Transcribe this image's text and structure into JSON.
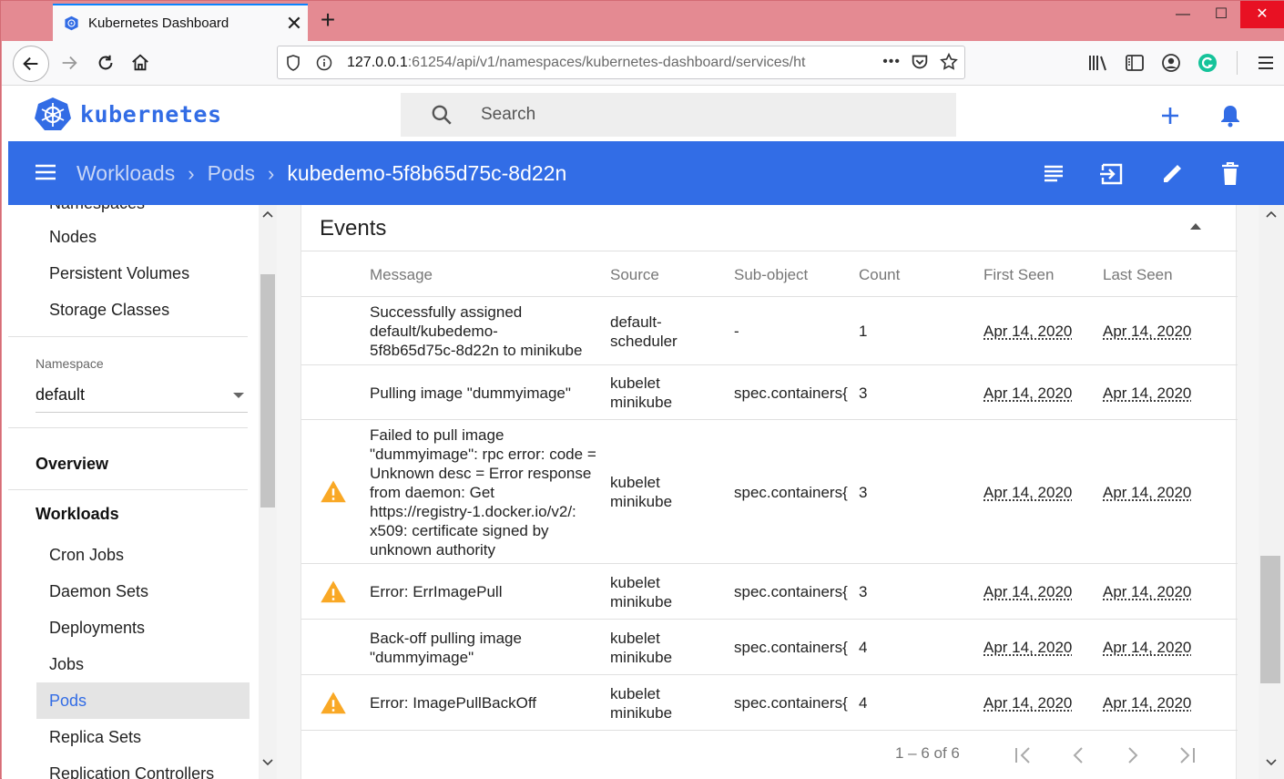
{
  "browser": {
    "tab_title": "Kubernetes Dashboard",
    "url_host": "127.0.0.1",
    "url_rest": ":61254/api/v1/namespaces/kubernetes-dashboard/services/ht",
    "page_actions": "•••",
    "titlebar_color": "#e48a92"
  },
  "header": {
    "brand": "kubernetes",
    "search_placeholder": "Search",
    "brand_color": "#326ce5"
  },
  "toolbar": {
    "breadcrumbs": [
      "Workloads",
      "Pods"
    ],
    "current": "kubedemo-5f8b65d75c-8d22n",
    "bar_color": "#326de6"
  },
  "sidebar": {
    "top_items": [
      "Namespaces",
      "Nodes",
      "Persistent Volumes",
      "Storage Classes"
    ],
    "namespace_label": "Namespace",
    "namespace_value": "default",
    "overview": "Overview",
    "workloads": "Workloads",
    "workload_items": [
      "Cron Jobs",
      "Daemon Sets",
      "Deployments",
      "Jobs",
      "Pods",
      "Replica Sets",
      "Replication Controllers"
    ],
    "active_item": "Pods"
  },
  "events": {
    "title": "Events",
    "columns": [
      "Message",
      "Source",
      "Sub-object",
      "Count",
      "First Seen",
      "Last Seen"
    ],
    "rows": [
      {
        "warning": false,
        "message": [
          "Successfully assigned",
          "default/kubedemo-",
          "5f8b65d75c-8d22n to minikube"
        ],
        "source": [
          "default-",
          "scheduler"
        ],
        "subobject": "-",
        "count": "1",
        "first_seen": "Apr 14, 2020",
        "last_seen": "Apr 14, 2020"
      },
      {
        "warning": false,
        "message": [
          "Pulling image \"dummyimage\""
        ],
        "source": [
          "kubelet",
          "minikube"
        ],
        "subobject": "spec.containers{",
        "count": "3",
        "first_seen": "Apr 14, 2020",
        "last_seen": "Apr 14, 2020"
      },
      {
        "warning": true,
        "message": [
          "Failed to pull image",
          "\"dummyimage\": rpc error: code =",
          "Unknown desc = Error response",
          "from daemon: Get",
          "https://registry-1.docker.io/v2/:",
          "x509: certificate signed by",
          "unknown authority"
        ],
        "source": [
          "kubelet",
          "minikube"
        ],
        "subobject": "spec.containers{",
        "count": "3",
        "first_seen": "Apr 14, 2020",
        "last_seen": "Apr 14, 2020"
      },
      {
        "warning": true,
        "message": [
          "Error: ErrImagePull"
        ],
        "source": [
          "kubelet",
          "minikube"
        ],
        "subobject": "spec.containers{",
        "count": "3",
        "first_seen": "Apr 14, 2020",
        "last_seen": "Apr 14, 2020"
      },
      {
        "warning": false,
        "message": [
          "Back-off pulling image",
          "\"dummyimage\""
        ],
        "source": [
          "kubelet",
          "minikube"
        ],
        "subobject": "spec.containers{",
        "count": "4",
        "first_seen": "Apr 14, 2020",
        "last_seen": "Apr 14, 2020"
      },
      {
        "warning": true,
        "message": [
          "Error: ImagePullBackOff"
        ],
        "source": [
          "kubelet",
          "minikube"
        ],
        "subobject": "spec.containers{",
        "count": "4",
        "first_seen": "Apr 14, 2020",
        "last_seen": "Apr 14, 2020"
      }
    ],
    "pagination": "1 – 6 of 6",
    "warning_color": "#f9a825"
  }
}
